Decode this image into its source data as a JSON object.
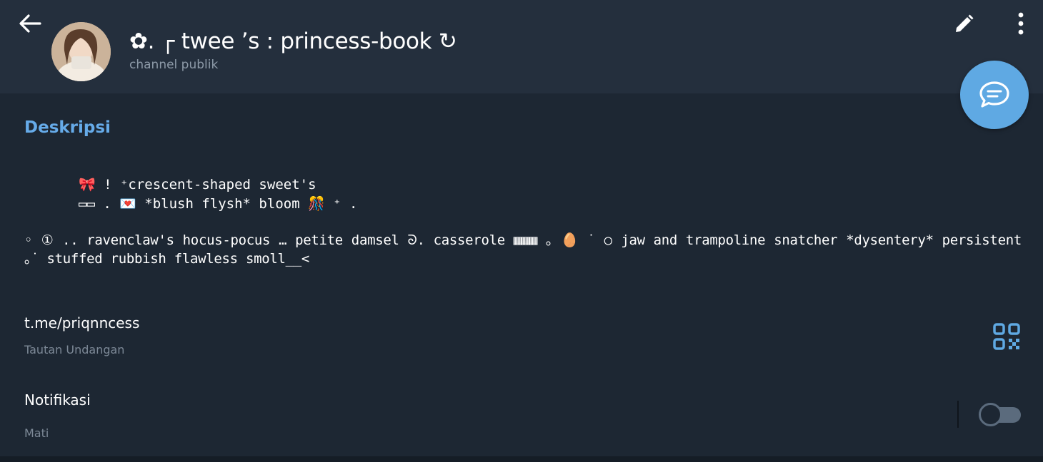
{
  "header": {
    "title": "✿. ┌ twee ’s : princess-book ↻",
    "subtitle": "channel publik",
    "back_icon": "back-arrow-icon",
    "edit_icon": "pencil-icon",
    "more_icon": "more-vertical-icon"
  },
  "fab": {
    "icon": "chat-bubble-icon",
    "color": "#5fa9e3"
  },
  "description": {
    "heading": "Deskripsi",
    "line1": "🎀 ! ⁺crescent-shaped sweet's",
    "line2": "▭▭ . 💌 *blush flysh* bloom 🎊 ⁺ .",
    "paragraph": "◦ ① .. ravenclaw's hocus-pocus … petite damsel ᘐ. casserole ▦▦▦ ｡ 🥚 ˙ ○ jaw and trampoline snatcher *dysentery* persistent ｡˙ stuffed rubbish flawless smoll__<"
  },
  "link": {
    "value": "t.me/priqnncess",
    "label": "Tautan Undangan",
    "icon": "qr-code-icon"
  },
  "notifications": {
    "label": "Notifikasi",
    "state": "Mati",
    "enabled": false
  },
  "colors": {
    "accent": "#66abe9",
    "background": "#1d2733",
    "header": "#242f3d"
  }
}
